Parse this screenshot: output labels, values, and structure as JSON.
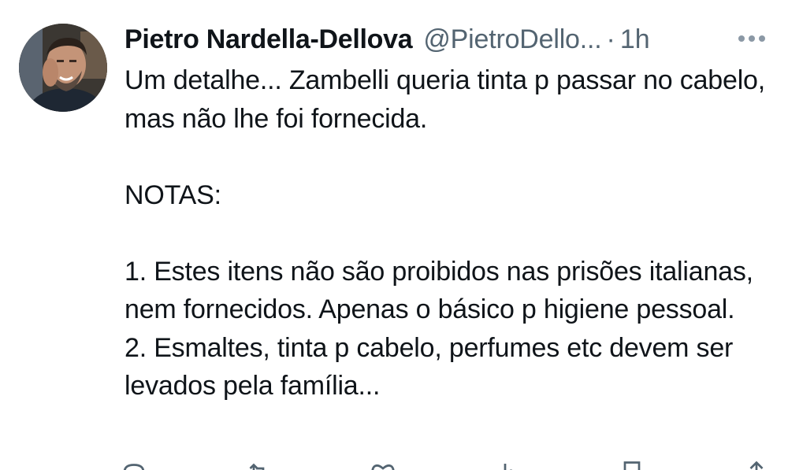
{
  "tweet": {
    "author": {
      "display_name": "Pietro Nardella-Dellova",
      "handle": "@PietroDello...",
      "separator": "·",
      "time": "1h",
      "avatar_icon": "user-avatar"
    },
    "text": {
      "p1": "Um detalhe... Zambelli queria tinta p passar no cabelo, mas não lhe foi fornecida.",
      "p2": "NOTAS:",
      "p3": "1. Estes itens não são proibidos nas prisões italianas, nem fornecidos. Apenas o básico p higiene pessoal.",
      "p4": "2. Esmaltes, tinta p cabelo, perfumes etc devem ser levados pela família..."
    },
    "more_icon": "more-horizontal-icon",
    "actions": [
      {
        "icon": "reply-icon"
      },
      {
        "icon": "retweet-icon"
      },
      {
        "icon": "like-icon"
      },
      {
        "icon": "views-icon"
      },
      {
        "icon": "bookmark-icon"
      },
      {
        "icon": "share-icon"
      }
    ],
    "colors": {
      "text": "#0f1419",
      "secondary": "#536471"
    }
  }
}
